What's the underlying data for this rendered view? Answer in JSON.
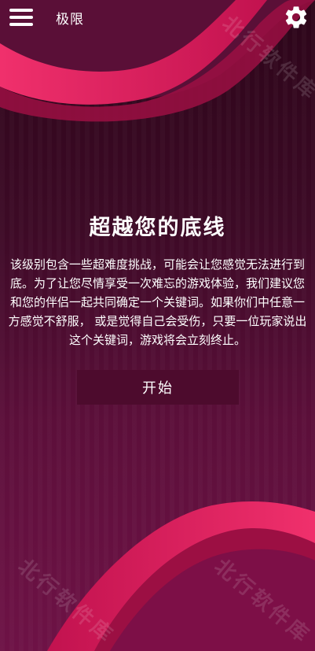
{
  "header": {
    "title": "极限",
    "menu_icon": "hamburger-menu-icon",
    "settings_icon": "gear-icon"
  },
  "main": {
    "heading": "超越您的底线",
    "description": "该级别包含一些超难度挑战，可能会让您感觉无法进行到底。为了让您尽情享受一次难忘的游戏体验，我们建议您和您的伴侣一起共同确定一个关键词。如果你们中任意一方感觉不舒服， 或是觉得自己会受伤，只要一位玩家说出这个关键词，游戏将会立刻终止。",
    "start_button_label": "开始"
  },
  "watermark": {
    "text": "北行软件库"
  },
  "colors": {
    "accent": "#e0175d",
    "background": "#3d0a26",
    "button": "#4d0b2d"
  }
}
